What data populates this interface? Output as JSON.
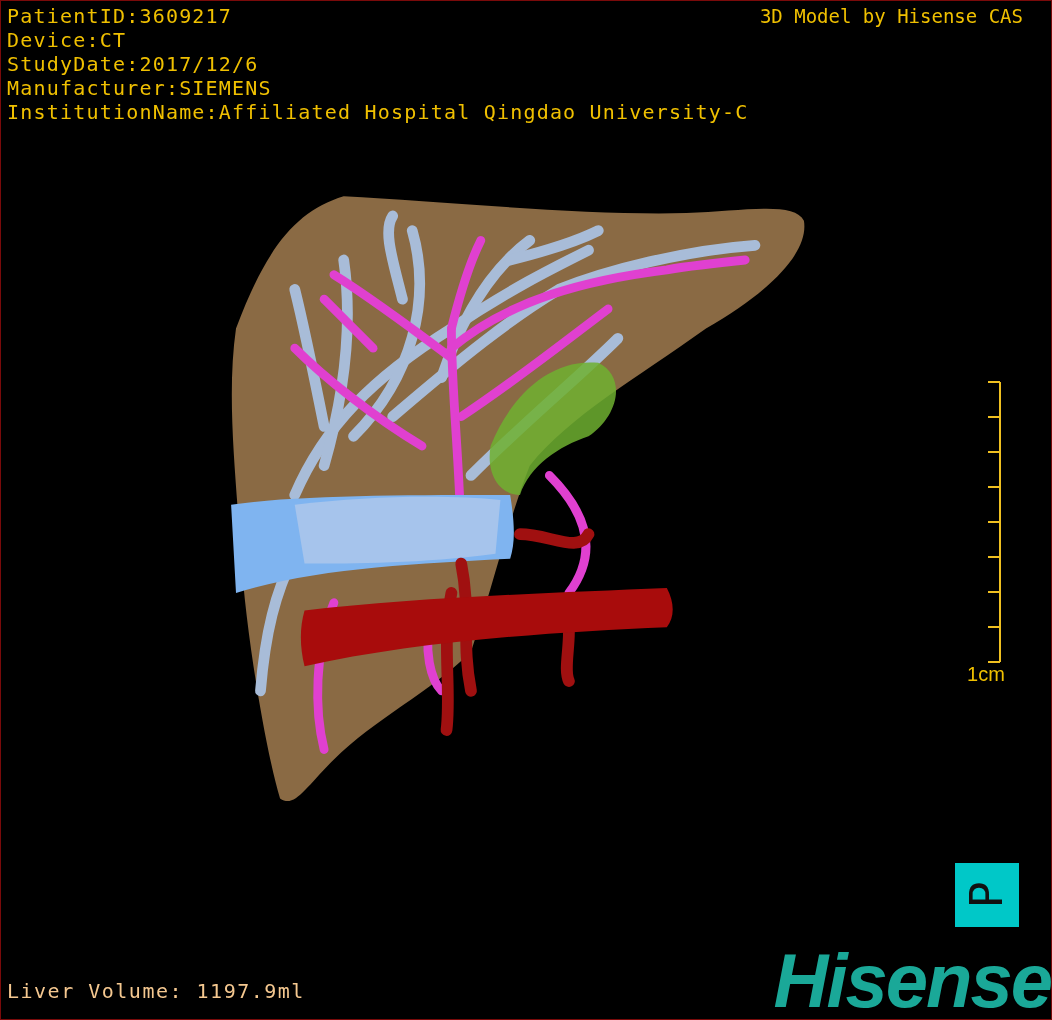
{
  "info_lines": [
    "PatientID:3609217",
    "Device:CT",
    "StudyDate:2017/12/6",
    "Manufacturer:SIEMENS",
    "InstitutionName:Affiliated Hospital Qingdao University-C"
  ],
  "title": "3D Model by Hisense CAS",
  "scale": {
    "label": "1cm"
  },
  "volume": "Liver Volume: 1197.9ml",
  "orientation_marker": "P",
  "logo": "Hisense"
}
